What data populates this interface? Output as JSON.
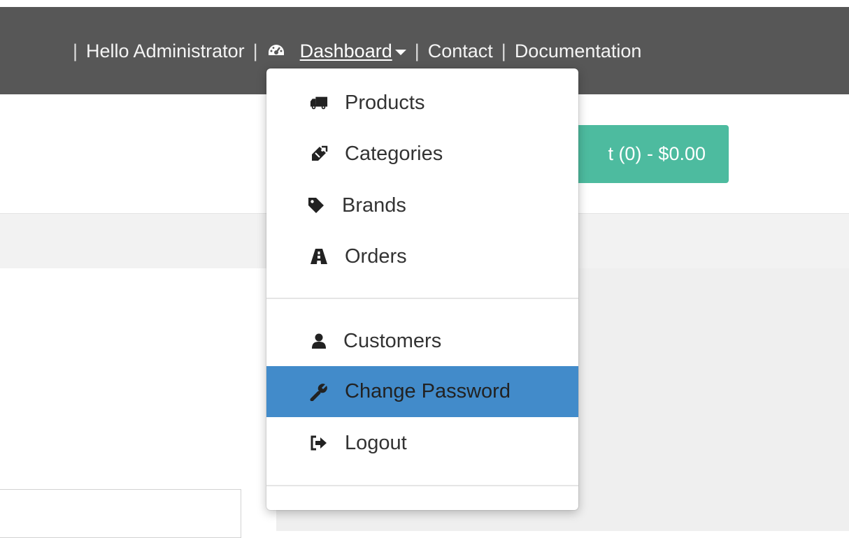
{
  "topnav": {
    "greeting": "Hello Administrator",
    "separator": "|",
    "dashboard_label": "Dashboard",
    "contact_label": "Contact",
    "documentation_label": "Documentation"
  },
  "cart": {
    "label": "t (0) - $0.00"
  },
  "dropdown": {
    "items": [
      {
        "label": "Products",
        "icon": "truck-icon"
      },
      {
        "label": "Categories",
        "icon": "tags-icon"
      },
      {
        "label": "Brands",
        "icon": "tag-icon"
      },
      {
        "label": "Orders",
        "icon": "road-icon"
      },
      {
        "label": "Customers",
        "icon": "user-icon"
      },
      {
        "label": "Change Password",
        "icon": "wrench-icon"
      },
      {
        "label": "Logout",
        "icon": "logout-icon"
      }
    ],
    "active_index": 5
  },
  "colors": {
    "topbar": "#575757",
    "cart_button": "#4dbb9f",
    "active_item": "#428bca"
  }
}
